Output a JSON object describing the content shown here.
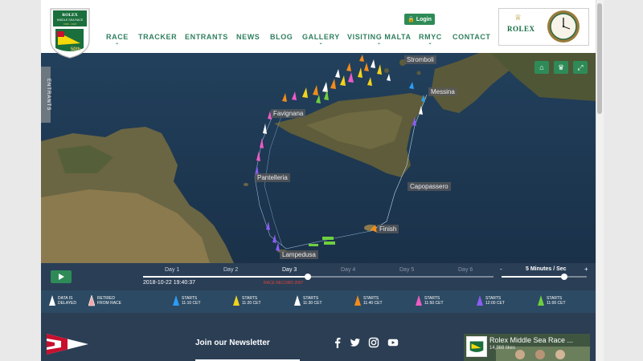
{
  "header": {
    "logo_text": [
      "ROLEX",
      "MIDDLE SEA RACE",
      "1968 - 2018",
      "50th"
    ],
    "login_label": "Login",
    "nav": [
      {
        "label": "RACE",
        "has_submenu": true
      },
      {
        "label": "TRACKER",
        "has_submenu": false
      },
      {
        "label": "ENTRANTS",
        "has_submenu": false
      },
      {
        "label": "NEWS",
        "has_submenu": false
      },
      {
        "label": "BLOG",
        "has_submenu": false
      },
      {
        "label": "GALLERY",
        "has_submenu": true
      },
      {
        "label": "VISITING MALTA",
        "has_submenu": true
      },
      {
        "label": "RMYC",
        "has_submenu": true
      },
      {
        "label": "CONTACT",
        "has_submenu": false
      }
    ],
    "sponsor": "ROLEX"
  },
  "map": {
    "entrants_tab": "ENTRANTS",
    "places": [
      "Stromboli",
      "Messina",
      "Favignana",
      "Pantelleria",
      "Capopassero",
      "Finish",
      "Lampedusa"
    ],
    "buttons": [
      "home-icon",
      "trophy-icon",
      "fullscreen-icon"
    ],
    "colors": {
      "sea": "#1c3550",
      "land": "#5c5a3c",
      "accent": "#2e8b57"
    }
  },
  "timeline": {
    "days": [
      "Day 1",
      "Day 2",
      "Day 3",
      "Day 4",
      "Day 5",
      "Day 6"
    ],
    "current_day_index": 2,
    "progress": 0.47,
    "datetime": "2018-10-22  19:40:37",
    "record_label": "RACE RECORD 2007",
    "speed": {
      "minus": "-",
      "label": "5 Minutes / Sec",
      "plus": "+",
      "level": 0.74
    }
  },
  "legend": [
    {
      "text": "DATA IS\nDELAYED",
      "color": "#ffffff"
    },
    {
      "text": "RETIRED\nFROM RACE",
      "color": "#f2a7a7"
    },
    {
      "text": "STARTS\n11:10 CET",
      "color": "#2a9df4"
    },
    {
      "text": "STARTS\n11:20 CET",
      "color": "#f2d31b"
    },
    {
      "text": "STARTS\n11:30 CET",
      "color": "#ffffff"
    },
    {
      "text": "STARTS\n11:40 CET",
      "color": "#f28c1b"
    },
    {
      "text": "STARTS\n11:50 CET",
      "color": "#ee5bc4"
    },
    {
      "text": "STARTS\n12:00 CET",
      "color": "#8b5cf6"
    },
    {
      "text": "STARTS\n11:00 CET",
      "color": "#6fcf3f"
    }
  ],
  "footer": {
    "newsletter": "Join our Newsletter",
    "social": [
      "facebook-icon",
      "twitter-icon",
      "instagram-icon",
      "youtube-icon"
    ],
    "fb_title": "Rolex Middle Sea Race ...",
    "fb_likes": "14,368 likes"
  }
}
